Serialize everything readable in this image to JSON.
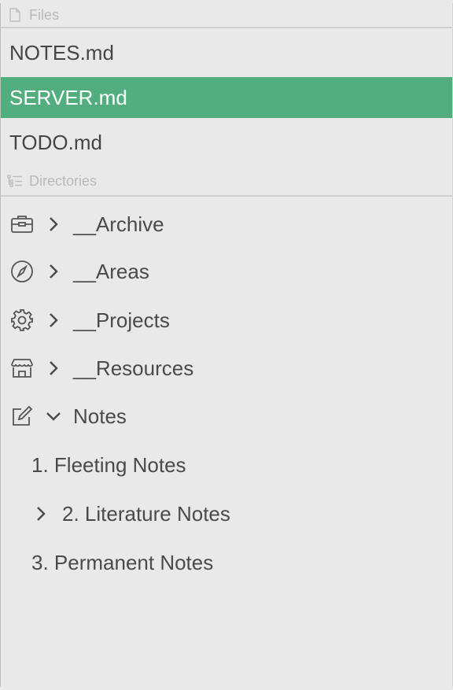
{
  "files_section": {
    "header": "Files",
    "header_icon": "file-icon",
    "items": [
      {
        "label": "NOTES.md",
        "selected": false
      },
      {
        "label": "SERVER.md",
        "selected": true
      },
      {
        "label": "TODO.md",
        "selected": false
      }
    ]
  },
  "directories_section": {
    "header": "Directories",
    "header_icon": "list-tree-icon",
    "items": [
      {
        "label": "__Archive",
        "icon": "briefcase-icon",
        "expanded": false
      },
      {
        "label": "__Areas",
        "icon": "compass-icon",
        "expanded": false
      },
      {
        "label": "__Projects",
        "icon": "gear-icon",
        "expanded": false
      },
      {
        "label": "__Resources",
        "icon": "store-icon",
        "expanded": false
      },
      {
        "label": "Notes",
        "icon": "edit-icon",
        "expanded": true
      }
    ],
    "notes_children": [
      {
        "label": "1. Fleeting Notes",
        "has_children": false
      },
      {
        "label": "2. Literature Notes",
        "has_children": true
      },
      {
        "label": "3. Permanent Notes",
        "has_children": false
      }
    ]
  },
  "colors": {
    "accent": "#52ad7f",
    "background": "#e9e9e9",
    "text": "#4a4a4a",
    "muted": "#b9b9b9"
  }
}
